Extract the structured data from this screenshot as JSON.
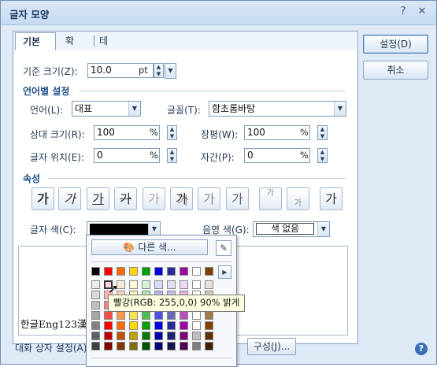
{
  "window": {
    "title": "글자 모양",
    "help": "?",
    "close": "✕"
  },
  "tabs": [
    {
      "label": "기본"
    },
    {
      "label": "확장"
    },
    {
      "label": "테두리/배경"
    }
  ],
  "basic": {
    "base_size_label": "기준 크기(Z):",
    "base_size_value": "10.0",
    "base_size_unit": "pt",
    "lang_section": "언어별 설정",
    "language_label": "언어(L):",
    "language_value": "대표",
    "font_label": "글꼴(T):",
    "font_value": "함초롬바탕",
    "rel_size_label": "상대 크기(R):",
    "rel_size_value": "100",
    "rel_size_unit": "%",
    "width_label": "장평(W):",
    "width_value": "100",
    "width_unit": "%",
    "pos_label": "글자 위치(E):",
    "pos_value": "0",
    "pos_unit": "%",
    "spacing_label": "자간(P):",
    "spacing_value": "0",
    "spacing_unit": "%",
    "attr_section": "속성",
    "attr_buttons": [
      "가",
      "가",
      "가",
      "가",
      "가",
      "가",
      "가",
      "가",
      "가",
      "가",
      "가"
    ],
    "text_color_label": "글자 색(C):",
    "text_color_value": "#000000",
    "shade_color_label": "음영 색(G):",
    "shade_color_value": "색 없음",
    "preview_text": "한글Eng123漢"
  },
  "palette": {
    "more_colors": "다른 색...",
    "colors_row": [
      "#000000",
      "#ff0000",
      "#ff6a00",
      "#ffd800",
      "#00a000",
      "#0000e0",
      "#2a2a9a",
      "#a000a0",
      "#ffffff",
      "#804000"
    ],
    "tooltip": "빨강(RGB: 255,0,0) 90% 밝게"
  },
  "buttons": {
    "ok": "설정(D)",
    "cancel": "취소",
    "compose": "구성(J)..."
  },
  "footer": {
    "dialog_settings": "대화 상자 설정(A)"
  }
}
